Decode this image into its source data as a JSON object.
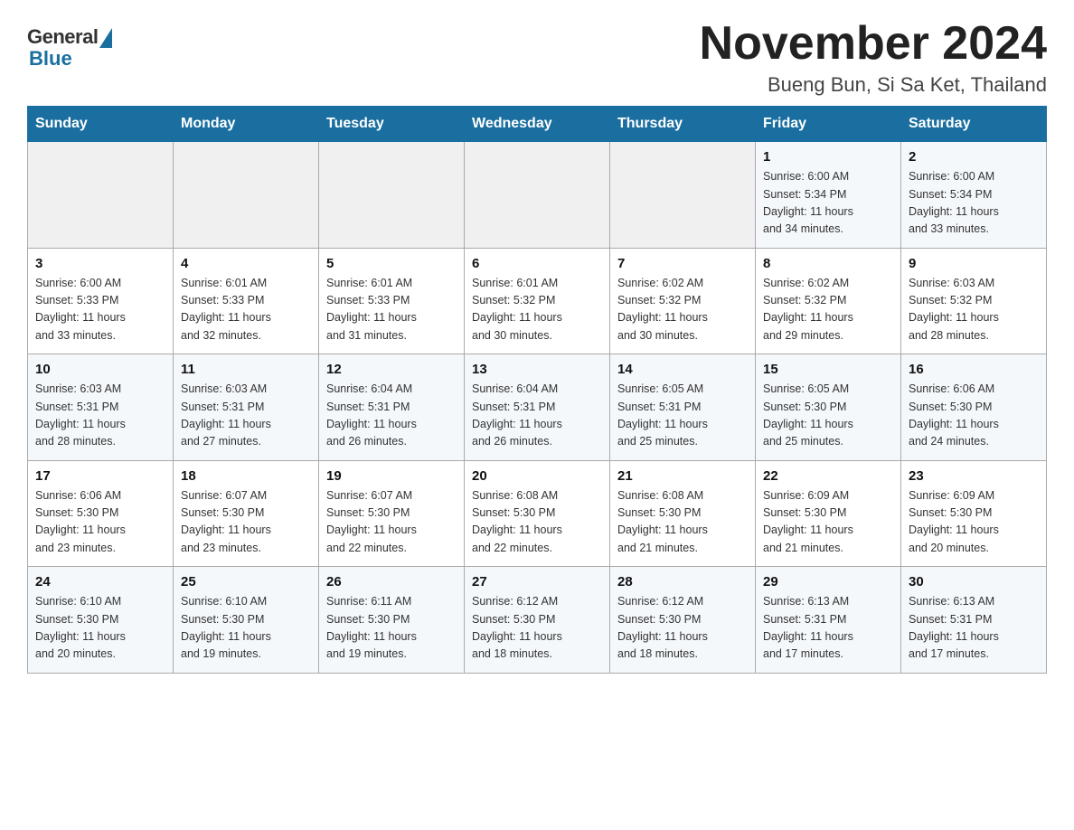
{
  "header": {
    "logo_general": "General",
    "logo_blue": "Blue",
    "month_title": "November 2024",
    "subtitle": "Bueng Bun, Si Sa Ket, Thailand"
  },
  "weekdays": [
    "Sunday",
    "Monday",
    "Tuesday",
    "Wednesday",
    "Thursday",
    "Friday",
    "Saturday"
  ],
  "weeks": [
    [
      {
        "day": "",
        "info": ""
      },
      {
        "day": "",
        "info": ""
      },
      {
        "day": "",
        "info": ""
      },
      {
        "day": "",
        "info": ""
      },
      {
        "day": "",
        "info": ""
      },
      {
        "day": "1",
        "info": "Sunrise: 6:00 AM\nSunset: 5:34 PM\nDaylight: 11 hours\nand 34 minutes."
      },
      {
        "day": "2",
        "info": "Sunrise: 6:00 AM\nSunset: 5:34 PM\nDaylight: 11 hours\nand 33 minutes."
      }
    ],
    [
      {
        "day": "3",
        "info": "Sunrise: 6:00 AM\nSunset: 5:33 PM\nDaylight: 11 hours\nand 33 minutes."
      },
      {
        "day": "4",
        "info": "Sunrise: 6:01 AM\nSunset: 5:33 PM\nDaylight: 11 hours\nand 32 minutes."
      },
      {
        "day": "5",
        "info": "Sunrise: 6:01 AM\nSunset: 5:33 PM\nDaylight: 11 hours\nand 31 minutes."
      },
      {
        "day": "6",
        "info": "Sunrise: 6:01 AM\nSunset: 5:32 PM\nDaylight: 11 hours\nand 30 minutes."
      },
      {
        "day": "7",
        "info": "Sunrise: 6:02 AM\nSunset: 5:32 PM\nDaylight: 11 hours\nand 30 minutes."
      },
      {
        "day": "8",
        "info": "Sunrise: 6:02 AM\nSunset: 5:32 PM\nDaylight: 11 hours\nand 29 minutes."
      },
      {
        "day": "9",
        "info": "Sunrise: 6:03 AM\nSunset: 5:32 PM\nDaylight: 11 hours\nand 28 minutes."
      }
    ],
    [
      {
        "day": "10",
        "info": "Sunrise: 6:03 AM\nSunset: 5:31 PM\nDaylight: 11 hours\nand 28 minutes."
      },
      {
        "day": "11",
        "info": "Sunrise: 6:03 AM\nSunset: 5:31 PM\nDaylight: 11 hours\nand 27 minutes."
      },
      {
        "day": "12",
        "info": "Sunrise: 6:04 AM\nSunset: 5:31 PM\nDaylight: 11 hours\nand 26 minutes."
      },
      {
        "day": "13",
        "info": "Sunrise: 6:04 AM\nSunset: 5:31 PM\nDaylight: 11 hours\nand 26 minutes."
      },
      {
        "day": "14",
        "info": "Sunrise: 6:05 AM\nSunset: 5:31 PM\nDaylight: 11 hours\nand 25 minutes."
      },
      {
        "day": "15",
        "info": "Sunrise: 6:05 AM\nSunset: 5:30 PM\nDaylight: 11 hours\nand 25 minutes."
      },
      {
        "day": "16",
        "info": "Sunrise: 6:06 AM\nSunset: 5:30 PM\nDaylight: 11 hours\nand 24 minutes."
      }
    ],
    [
      {
        "day": "17",
        "info": "Sunrise: 6:06 AM\nSunset: 5:30 PM\nDaylight: 11 hours\nand 23 minutes."
      },
      {
        "day": "18",
        "info": "Sunrise: 6:07 AM\nSunset: 5:30 PM\nDaylight: 11 hours\nand 23 minutes."
      },
      {
        "day": "19",
        "info": "Sunrise: 6:07 AM\nSunset: 5:30 PM\nDaylight: 11 hours\nand 22 minutes."
      },
      {
        "day": "20",
        "info": "Sunrise: 6:08 AM\nSunset: 5:30 PM\nDaylight: 11 hours\nand 22 minutes."
      },
      {
        "day": "21",
        "info": "Sunrise: 6:08 AM\nSunset: 5:30 PM\nDaylight: 11 hours\nand 21 minutes."
      },
      {
        "day": "22",
        "info": "Sunrise: 6:09 AM\nSunset: 5:30 PM\nDaylight: 11 hours\nand 21 minutes."
      },
      {
        "day": "23",
        "info": "Sunrise: 6:09 AM\nSunset: 5:30 PM\nDaylight: 11 hours\nand 20 minutes."
      }
    ],
    [
      {
        "day": "24",
        "info": "Sunrise: 6:10 AM\nSunset: 5:30 PM\nDaylight: 11 hours\nand 20 minutes."
      },
      {
        "day": "25",
        "info": "Sunrise: 6:10 AM\nSunset: 5:30 PM\nDaylight: 11 hours\nand 19 minutes."
      },
      {
        "day": "26",
        "info": "Sunrise: 6:11 AM\nSunset: 5:30 PM\nDaylight: 11 hours\nand 19 minutes."
      },
      {
        "day": "27",
        "info": "Sunrise: 6:12 AM\nSunset: 5:30 PM\nDaylight: 11 hours\nand 18 minutes."
      },
      {
        "day": "28",
        "info": "Sunrise: 6:12 AM\nSunset: 5:30 PM\nDaylight: 11 hours\nand 18 minutes."
      },
      {
        "day": "29",
        "info": "Sunrise: 6:13 AM\nSunset: 5:31 PM\nDaylight: 11 hours\nand 17 minutes."
      },
      {
        "day": "30",
        "info": "Sunrise: 6:13 AM\nSunset: 5:31 PM\nDaylight: 11 hours\nand 17 minutes."
      }
    ]
  ]
}
